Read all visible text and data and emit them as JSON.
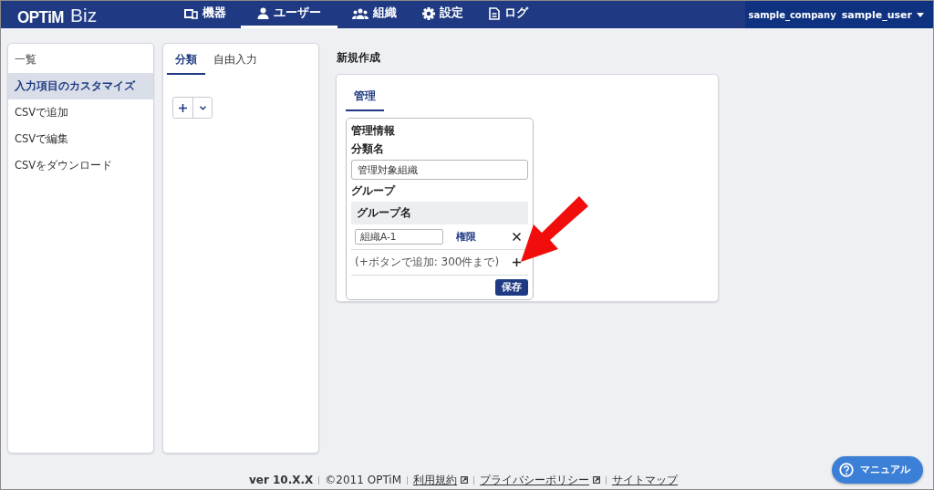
{
  "header": {
    "logo": {
      "brand": "OPTiM",
      "product": "Biz"
    },
    "nav": [
      {
        "label": "機器",
        "selected": false
      },
      {
        "label": "ユーザー",
        "selected": true
      },
      {
        "label": "組織",
        "selected": false
      },
      {
        "label": "設定",
        "selected": false
      },
      {
        "label": "ログ",
        "selected": false
      }
    ],
    "company": "sample_company",
    "user": "sample_user"
  },
  "sidebar": {
    "items": [
      {
        "label": "一覧",
        "selected": false
      },
      {
        "label": "入力項目のカスタマイズ",
        "selected": true
      },
      {
        "label": "CSVで追加",
        "selected": false
      },
      {
        "label": "CSVで編集",
        "selected": false
      },
      {
        "label": "CSVをダウンロード",
        "selected": false
      }
    ]
  },
  "category_panel": {
    "tabs": [
      {
        "label": "分類",
        "selected": true
      },
      {
        "label": "自由入力",
        "selected": false
      }
    ]
  },
  "editor": {
    "heading": "新規作成",
    "tabs": [
      {
        "label": "管理",
        "selected": true
      }
    ],
    "section": {
      "title": "管理情報",
      "name_label": "分類名",
      "name_value": "管理対象組織",
      "group_label": "グループ",
      "group_column": "グループ名",
      "groups": [
        {
          "value": "組織A-1",
          "link": "権限"
        }
      ],
      "hint": "(+ボタンで追加: 300件まで)",
      "save": "保存"
    }
  },
  "footer": {
    "items": [
      {
        "label": "ver 10.X.X",
        "kind": "version"
      },
      {
        "label": "©2011 OPTiM",
        "kind": "text"
      },
      {
        "label": "利用規約",
        "kind": "external_link"
      },
      {
        "label": "プライバシーポリシー",
        "kind": "external_link"
      },
      {
        "label": "サイトマップ",
        "kind": "link"
      }
    ]
  },
  "help_button": "マニュアル"
}
